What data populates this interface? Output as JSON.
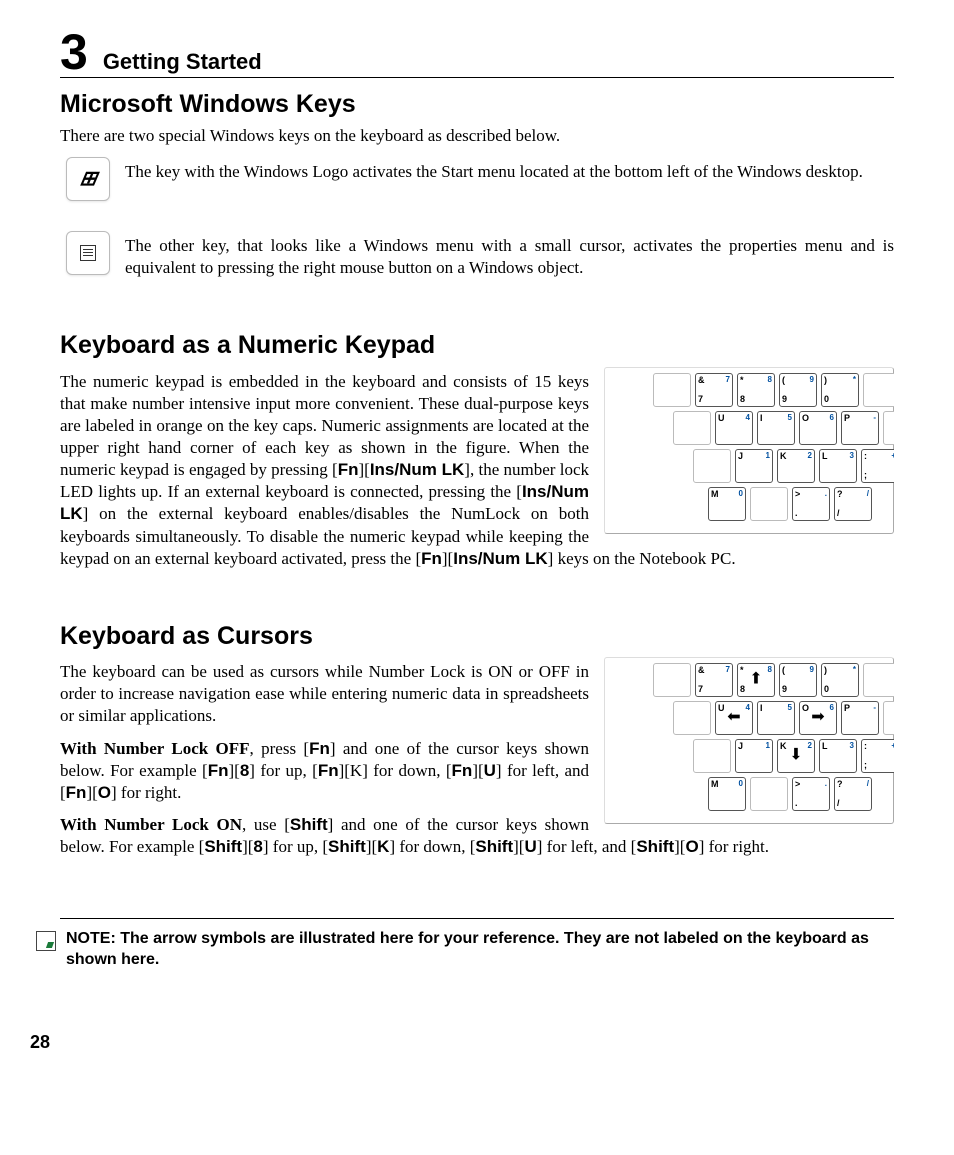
{
  "chapter": {
    "number": "3",
    "title": "Getting Started"
  },
  "page_number": "28",
  "section_windows": {
    "heading": "Microsoft Windows Keys",
    "intro": "There are two special Windows keys on the keyboard as described below.",
    "win_key_desc": "The key with the Windows Logo activates the Start menu located at the bottom left of the Windows desktop.",
    "menu_key_desc": "The other key, that looks like a Windows menu with a small cursor, activates the properties menu and is equivalent to pressing the right mouse button on a Windows object."
  },
  "section_numpad": {
    "heading": "Keyboard as a Numeric Keypad",
    "p1a": "The numeric keypad is embedded in the keyboard and consists of 15 keys that make number intensive input more convenient. These dual-purpose keys are labeled in orange on the key caps. Numeric assignments are located at the upper right hand corner of each key as shown in the figure. When the numeric keypad is engaged by pressing [",
    "p1b": "], the number lock LED lights up. If an external keyboard is connected, pressing the [",
    "p1c": "] on the external keyboard enables/disables the NumLock on both keyboards simultaneously. To disable the numeric keypad while keeping the keypad on an external keyboard activated, press the  [",
    "p1d": "] keys on the Notebook PC.",
    "fn": "Fn",
    "insnum": "Ins/Num LK",
    "insnum2": "Ins/Num LK",
    "fn2": "Fn",
    "insnum3": "Ins/Num LK"
  },
  "section_cursors": {
    "heading": "Keyboard as Cursors",
    "p1": "The keyboard can be used as cursors while Number Lock is ON or OFF in order to increase navigation ease while entering numeric data in spreadsheets or similar applications.",
    "off_lead": "With Number Lock OFF",
    "off_rest": ", press [",
    "off_a": "] and one of the cursor keys shown below. For example [",
    "off_b": "] for up, [",
    "off_c": "][K] for down, [",
    "off_d": "] for left, and [",
    "off_e": "] for right.",
    "on_lead": "With Number Lock ON",
    "on_rest": ", use [",
    "on_a": "] and one of the cursor keys shown below. For example [",
    "on_b": "] for up, [",
    "on_c": "] for down, [",
    "on_d": "] for left, and [",
    "on_e": "] for right.",
    "Fn": "Fn",
    "8": "8",
    "U": "U",
    "O": "O",
    "K": "K",
    "Shift": "Shift"
  },
  "note": "NOTE: The arrow symbols are illustrated here for your reference. They are not labeled on the keyboard as shown here.",
  "keys": {
    "r1": [
      {
        "ul": "&",
        "ur": "7",
        "dl": "7",
        "dr": ""
      },
      {
        "ul": "*",
        "ur": "8",
        "dl": "8",
        "dr": ""
      },
      {
        "ul": "(",
        "ur": "9",
        "dl": "9",
        "dr": ""
      },
      {
        "ul": ")",
        "ur": "*",
        "dl": "0",
        "dr": ""
      }
    ],
    "r2": [
      {
        "ul": "U",
        "ur": "4",
        "dl": "",
        "dr": ""
      },
      {
        "ul": "I",
        "ur": "5",
        "dl": "",
        "dr": ""
      },
      {
        "ul": "O",
        "ur": "6",
        "dl": "",
        "dr": ""
      },
      {
        "ul": "P",
        "ur": "-",
        "dl": "",
        "dr": ""
      }
    ],
    "r3": [
      {
        "ul": "J",
        "ur": "1",
        "dl": "",
        "dr": ""
      },
      {
        "ul": "K",
        "ur": "2",
        "dl": "",
        "dr": ""
      },
      {
        "ul": "L",
        "ur": "3",
        "dl": "",
        "dr": ""
      },
      {
        "ul": ":",
        "ur": "+",
        "dl": ";",
        "dr": ""
      }
    ],
    "r4": [
      {
        "ul": "M",
        "ur": "0",
        "dl": "",
        "dr": ""
      },
      {
        "ul": ">",
        "ur": ".",
        "dl": ".",
        "dr": ""
      },
      {
        "ul": "?",
        "ur": "/",
        "dl": "/",
        "dr": ""
      }
    ],
    "arrows": {
      "up": "8",
      "down": "K",
      "left": "U",
      "right": "O"
    }
  }
}
